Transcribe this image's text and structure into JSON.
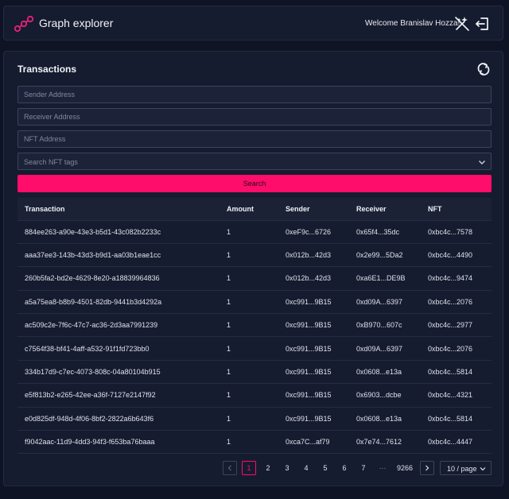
{
  "header": {
    "title": "Graph explorer",
    "welcome": "Welcome Branislav Hozza!",
    "icons": [
      "logo-icon",
      "magic-wand-icon",
      "logout-icon"
    ]
  },
  "panel": {
    "title": "Transactions",
    "refresh_icon": "refresh-icon"
  },
  "form": {
    "sender_placeholder": "Sender Address",
    "receiver_placeholder": "Receiver Address",
    "nft_placeholder": "NFT Address",
    "tags_placeholder": "Search NFT tags",
    "search_label": "Search"
  },
  "table": {
    "columns": [
      "Transaction",
      "Amount",
      "Sender",
      "Receiver",
      "NFT"
    ],
    "rows": [
      {
        "tx": "884ee263-a90e-43e3-b5d1-43c082b2233c",
        "amount": "1",
        "sender": "0xeF9c...6726",
        "receiver": "0x65f4...35dc",
        "nft": "0xbc4c...7578"
      },
      {
        "tx": "aaa37ee3-143b-43d3-b9d1-aa03b1eae1cc",
        "amount": "1",
        "sender": "0x012b...42d3",
        "receiver": "0x2e99...5Da2",
        "nft": "0xbc4c...4490"
      },
      {
        "tx": "260b5fa2-bd2e-4629-8e20-a18839964836",
        "amount": "1",
        "sender": "0x012b...42d3",
        "receiver": "0xa6E1...DE9B",
        "nft": "0xbc4c...9474"
      },
      {
        "tx": "a5a75ea8-b8b9-4501-82db-9441b3d4292a",
        "amount": "1",
        "sender": "0xc991...9B15",
        "receiver": "0xd09A...6397",
        "nft": "0xbc4c...2076"
      },
      {
        "tx": "ac509c2e-7f6c-47c7-ac36-2d3aa7991239",
        "amount": "1",
        "sender": "0xc991...9B15",
        "receiver": "0xB970...607c",
        "nft": "0xbc4c...2977"
      },
      {
        "tx": "c7564f38-bf41-4aff-a532-91f1fd723bb0",
        "amount": "1",
        "sender": "0xc991...9B15",
        "receiver": "0xd09A...6397",
        "nft": "0xbc4c...2076"
      },
      {
        "tx": "334b17d9-c7ec-4073-808c-04a80104b915",
        "amount": "1",
        "sender": "0xc991...9B15",
        "receiver": "0x0608...e13a",
        "nft": "0xbc4c...5814"
      },
      {
        "tx": "e5f813b2-e265-42ee-a36f-7127e2147f92",
        "amount": "1",
        "sender": "0xc991...9B15",
        "receiver": "0x6903...dcbe",
        "nft": "0xbc4c...4321"
      },
      {
        "tx": "e0d825df-948d-4f06-8bf2-2822a6b643f6",
        "amount": "1",
        "sender": "0xc991...9B15",
        "receiver": "0x0608...e13a",
        "nft": "0xbc4c...5814"
      },
      {
        "tx": "f9042aac-11d9-4dd3-94f3-f653ba76baaa",
        "amount": "1",
        "sender": "0xca7C...af79",
        "receiver": "0x7e74...7612",
        "nft": "0xbc4c...4447"
      }
    ]
  },
  "pagination": {
    "pages": [
      "1",
      "2",
      "3",
      "4",
      "5",
      "6",
      "7"
    ],
    "current": "1",
    "ellipsis": "···",
    "last": "9266",
    "page_size": "10 / page"
  },
  "colors": {
    "accent": "#ff0d6b",
    "background": "#0f1424",
    "panel": "#161c2f"
  }
}
